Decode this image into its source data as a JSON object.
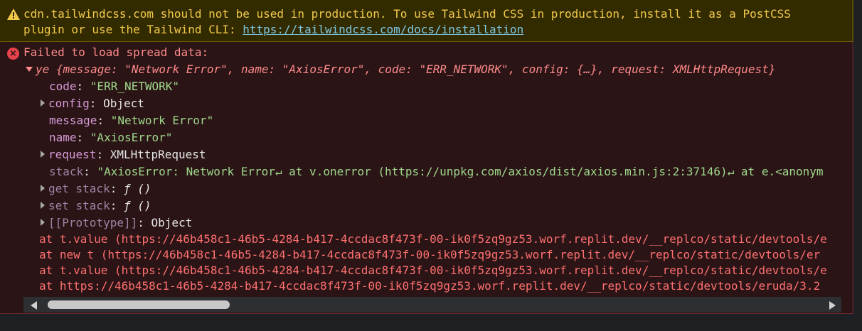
{
  "warning": {
    "text_line1": "cdn.tailwindcss.com should not be used in production. To use Tailwind CSS in production, install it as a PostCSS",
    "text_line2_prefix": "plugin or use the Tailwind CLI: ",
    "link": "https://tailwindcss.com/docs/installation"
  },
  "error": {
    "title": "Failed to load spread data:",
    "summary_prefix": "ye {message: ",
    "summary_message": "\"Network Error\"",
    "summary_name_key": ", name: ",
    "summary_name": "\"AxiosError\"",
    "summary_code_key": ", code: ",
    "summary_code": "\"ERR_NETWORK\"",
    "summary_rest": ", config: {…}, request: XMLHttpRequest}",
    "props": {
      "code_key": "code",
      "code_val": "\"ERR_NETWORK\"",
      "config_key": "config",
      "config_val": "Object",
      "message_key": "message",
      "message_val": "\"Network Error\"",
      "name_key": "name",
      "name_val": "\"AxiosError\"",
      "request_key": "request",
      "request_val": "XMLHttpRequest",
      "stack_key": "stack",
      "stack_val": "\"AxiosError: Network Error↵ at v.onerror (https://unpkg.com/axios/dist/axios.min.js:2:37146)↵ at e.<anonym",
      "get_stack_key": "get stack",
      "get_stack_val": "ƒ ()",
      "set_stack_key": "set stack",
      "set_stack_val": "ƒ ()",
      "prototype_key": "[[Prototype]]",
      "prototype_val": "Object"
    },
    "trace": [
      "at t.value (https://46b458c1-46b5-4284-b417-4ccdac8f473f-00-ik0f5zq9gz53.worf.replit.dev/__replco/static/devtools/e",
      "at new t (https://46b458c1-46b5-4284-b417-4ccdac8f473f-00-ik0f5zq9gz53.worf.replit.dev/__replco/static/devtools/er",
      "at t.value (https://46b458c1-46b5-4284-b417-4ccdac8f473f-00-ik0f5zq9gz53.worf.replit.dev/__replco/static/devtools/e",
      "at https://46b458c1-46b5-4284-b417-4ccdac8f473f-00-ik0f5zq9gz53.worf.replit.dev/__replco/static/devtools/eruda/3.2"
    ]
  },
  "icons": {
    "warning": "warning-triangle-icon",
    "error": "error-circle-icon"
  },
  "colors": {
    "warning_bg": "#332b00",
    "warning_text": "#f2c94c",
    "error_bg": "#2a1416",
    "error_text": "#ff8a8a",
    "string": "#9fd88a",
    "key": "#d59ad6"
  }
}
